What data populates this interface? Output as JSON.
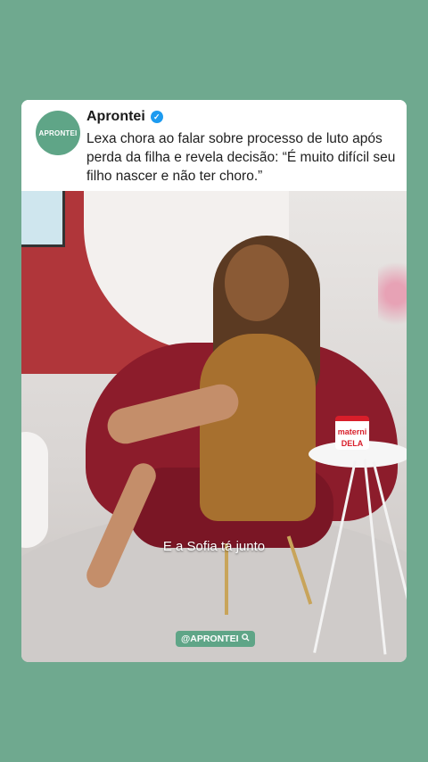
{
  "post": {
    "account_name": "Aprontei",
    "avatar_text": "APRONTEI",
    "headline": "Lexa chora ao falar sobre processo de luto após perda da filha e revela decisão: “É muito difícil seu filho nascer e não ter choro.”",
    "verified_icon": "verified-badge-icon"
  },
  "video": {
    "subtitle": "E a Sofia tá junto",
    "mug_text": "materni DELA",
    "watermark": "@APRONTEI",
    "watermark_icon": "search-icon"
  },
  "colors": {
    "background": "#6fa98f",
    "brand_green": "#5fa587",
    "chair_red": "#8c1c2b",
    "wall_red": "#b0363a"
  }
}
